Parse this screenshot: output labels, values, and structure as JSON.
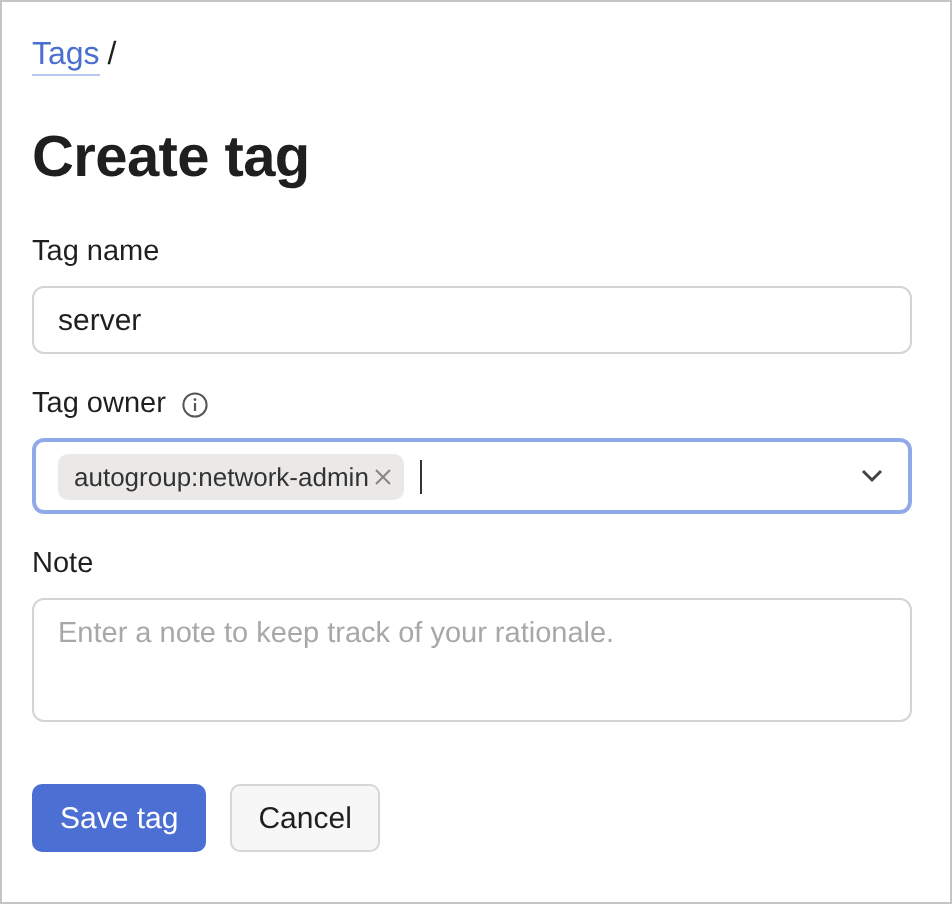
{
  "breadcrumb": {
    "link": "Tags",
    "separator": "/"
  },
  "title": "Create tag",
  "fields": [
    {
      "kind": "text",
      "label": "Tag name",
      "value": "server"
    },
    {
      "kind": "multiselect",
      "label": "Tag owner",
      "info": true,
      "focused": true,
      "chips": [
        "autogroup:network-admin"
      ]
    },
    {
      "kind": "textarea",
      "label": "Note",
      "placeholder": "Enter a note to keep track of your rationale."
    }
  ],
  "buttons": [
    {
      "label": "Save tag",
      "kind": "primary"
    },
    {
      "label": "Cancel",
      "kind": "secondary"
    }
  ]
}
